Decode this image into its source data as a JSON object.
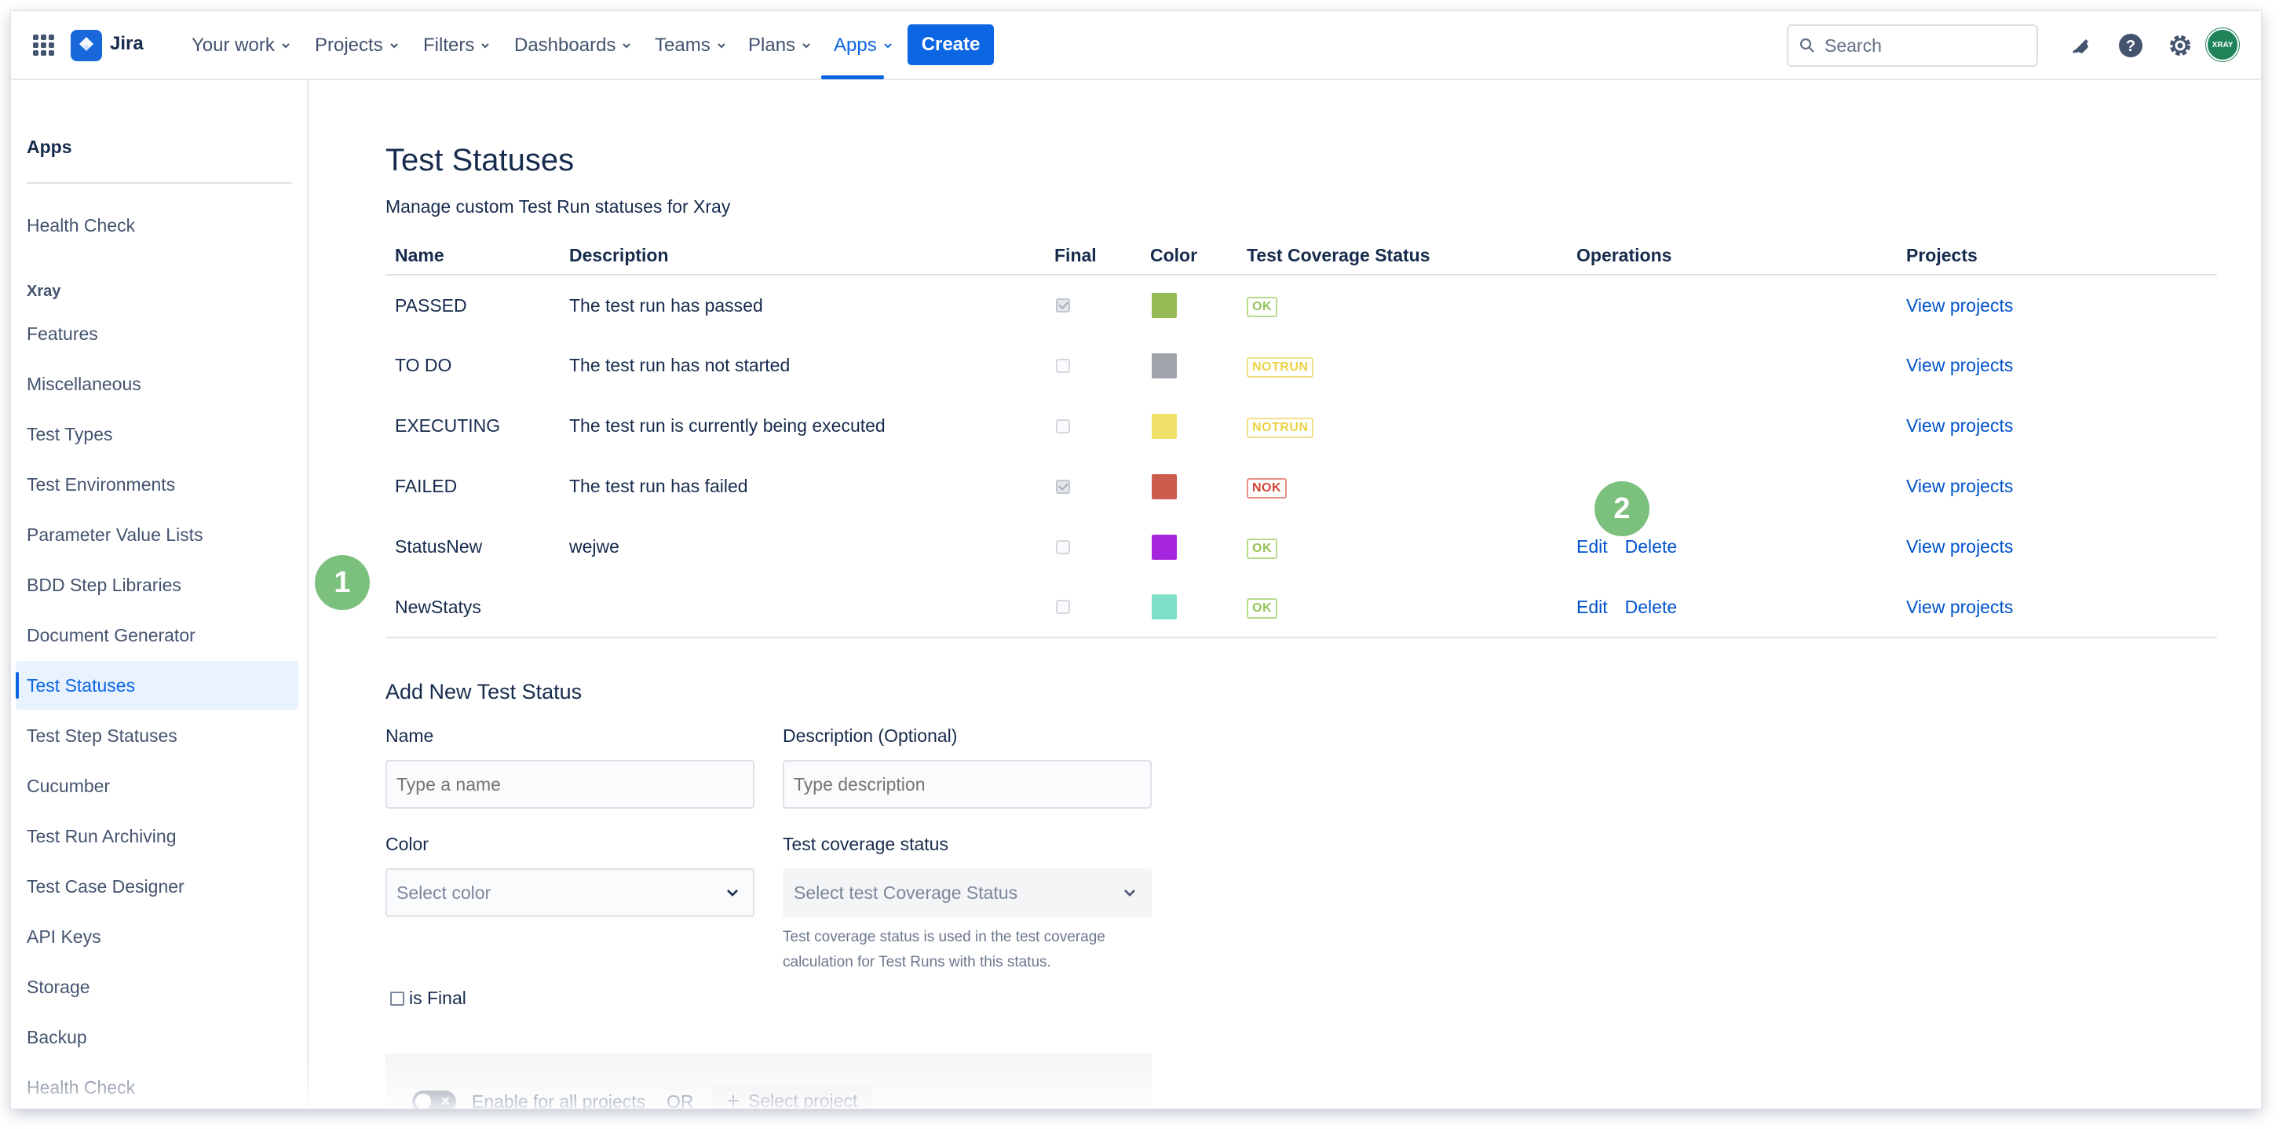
{
  "topnav": {
    "logo": "Jira",
    "items": [
      {
        "label": "Your work"
      },
      {
        "label": "Projects"
      },
      {
        "label": "Filters"
      },
      {
        "label": "Dashboards"
      },
      {
        "label": "Teams"
      },
      {
        "label": "Plans"
      },
      {
        "label": "Apps"
      }
    ],
    "active_item": "Apps",
    "create_label": "Create",
    "search_placeholder": "Search",
    "avatar_text": "XRAY",
    "accent": "#0c66e4"
  },
  "sidebar": {
    "heading": "Apps",
    "top_items": [
      {
        "label": "Health Check"
      }
    ],
    "section": "Xray",
    "items": [
      {
        "label": "Features"
      },
      {
        "label": "Miscellaneous"
      },
      {
        "label": "Test Types"
      },
      {
        "label": "Test Environments"
      },
      {
        "label": "Parameter Value Lists"
      },
      {
        "label": "BDD Step Libraries"
      },
      {
        "label": "Document Generator"
      },
      {
        "label": "Test Statuses"
      },
      {
        "label": "Test Step Statuses"
      },
      {
        "label": "Cucumber"
      },
      {
        "label": "Test Run Archiving"
      },
      {
        "label": "Test Case Designer"
      },
      {
        "label": "API Keys"
      },
      {
        "label": "Storage"
      },
      {
        "label": "Backup"
      },
      {
        "label": "Health Check"
      }
    ],
    "active_item": "Test Statuses"
  },
  "main": {
    "title": "Test Statuses",
    "subtitle": "Manage custom Test Run statuses for Xray",
    "columns": [
      "Name",
      "Description",
      "Final",
      "Color",
      "Test Coverage Status",
      "Operations",
      "Projects"
    ],
    "rows": [
      {
        "name": "PASSED",
        "description": "The test run has passed",
        "final": true,
        "color": "#95bb57",
        "coverage": "OK",
        "operations": [],
        "projects": "View projects"
      },
      {
        "name": "TO DO",
        "description": "The test run has not started",
        "final": false,
        "color": "#a1a4ab",
        "coverage": "NOTRUN",
        "operations": [],
        "projects": "View projects"
      },
      {
        "name": "EXECUTING",
        "description": "The test run is currently being executed",
        "final": false,
        "color": "#f1e06a",
        "coverage": "NOTRUN",
        "operations": [],
        "projects": "View projects"
      },
      {
        "name": "FAILED",
        "description": "The test run has failed",
        "final": true,
        "color": "#cc5b4c",
        "coverage": "NOK",
        "operations": [],
        "projects": "View projects"
      },
      {
        "name": "StatusNew",
        "description": "wejwe",
        "final": false,
        "color": "#a626de",
        "coverage": "OK",
        "operations": [
          "Edit",
          "Delete"
        ],
        "projects": "View projects"
      },
      {
        "name": "NewStatys",
        "description": "",
        "final": false,
        "color": "#7ee0c6",
        "coverage": "OK",
        "operations": [
          "Edit",
          "Delete"
        ],
        "projects": "View projects"
      }
    ],
    "callouts": {
      "badge1": "1",
      "badge2": "2"
    }
  },
  "form": {
    "title": "Add New Test Status",
    "name_label": "Name",
    "name_placeholder": "Type a name",
    "description_label": "Description (Optional)",
    "description_placeholder": "Type description",
    "color_label": "Color",
    "color_placeholder": "Select color",
    "coverage_label": "Test coverage status",
    "coverage_placeholder": "Select test Coverage Status",
    "coverage_help": "Test coverage status is used in the test coverage calculation for Test Runs with this status.",
    "is_final_label": "is Final",
    "enable_all_label": "Enable for all projects",
    "or_label": "OR",
    "select_project_label": "Select project"
  }
}
